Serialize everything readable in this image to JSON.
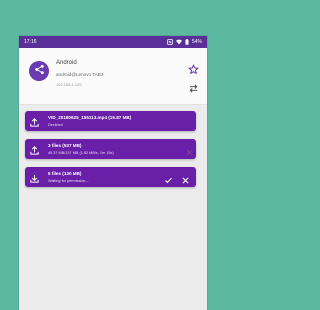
{
  "status": {
    "time": "17:16",
    "battery": "54%"
  },
  "device": {
    "name": "Android",
    "account": "android@Lenovo TAB3",
    "ip": "192.168.1.125"
  },
  "transfers": [
    {
      "title": "VID_20180625_155113.mp4 (15.87 MB)",
      "status": "Declined",
      "direction": "upload"
    },
    {
      "title": "3 files (537 MB)",
      "status": "45.37 MB/137 MB (1.82 MB/s, 1m 15s)",
      "direction": "upload"
    },
    {
      "title": "5 files (130 MB)",
      "status": "Waiting for permission...",
      "direction": "download"
    }
  ]
}
